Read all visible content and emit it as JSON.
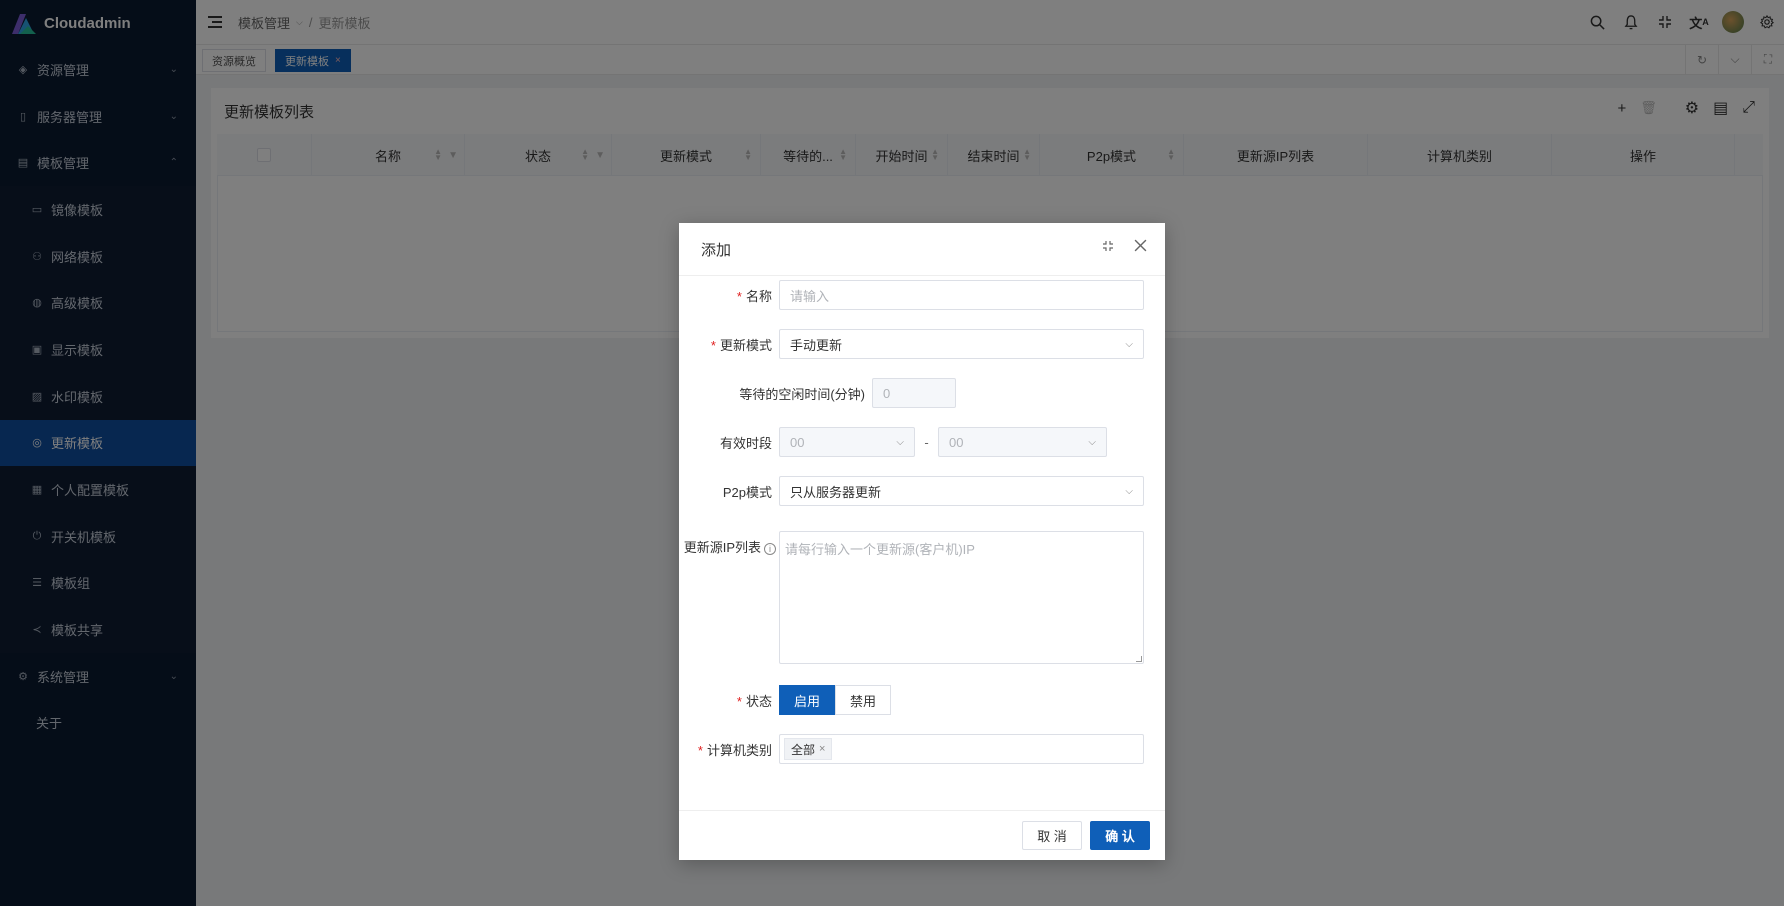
{
  "app": {
    "name": "Cloudadmin"
  },
  "sidebar": {
    "items": [
      {
        "label": "资源管理",
        "icon": "resource-icon",
        "type": "top",
        "expanded": false
      },
      {
        "label": "服务器管理",
        "icon": "server-icon",
        "type": "top",
        "expanded": false
      },
      {
        "label": "模板管理",
        "icon": "template-icon",
        "type": "top",
        "expanded": true
      },
      {
        "label": "镜像模板",
        "icon": "disk-icon",
        "type": "sub"
      },
      {
        "label": "网络模板",
        "icon": "network-icon",
        "type": "sub"
      },
      {
        "label": "高级模板",
        "icon": "advanced-icon",
        "type": "sub"
      },
      {
        "label": "显示模板",
        "icon": "display-icon",
        "type": "sub"
      },
      {
        "label": "水印模板",
        "icon": "watermark-icon",
        "type": "sub"
      },
      {
        "label": "更新模板",
        "icon": "update-icon",
        "type": "sub",
        "active": true
      },
      {
        "label": "个人配置模板",
        "icon": "profile-icon",
        "type": "sub"
      },
      {
        "label": "开关机模板",
        "icon": "power-icon",
        "type": "sub"
      },
      {
        "label": "模板组",
        "icon": "group-icon",
        "type": "sub"
      },
      {
        "label": "模板共享",
        "icon": "share-icon",
        "type": "sub"
      },
      {
        "label": "系统管理",
        "icon": "settings-icon",
        "type": "top",
        "expanded": false
      },
      {
        "label": "关于",
        "icon": "",
        "type": "plain"
      }
    ]
  },
  "topbar": {
    "breadcrumb": [
      "模板管理",
      "更新模板"
    ],
    "icons": [
      "search-icon",
      "bell-icon",
      "fullscreen-icon",
      "translate-icon",
      "avatar",
      "gear-icon"
    ]
  },
  "tabs": [
    {
      "label": "资源概览",
      "active": false
    },
    {
      "label": "更新模板",
      "active": true,
      "close": "×"
    }
  ],
  "card": {
    "title": "更新模板列表",
    "columns": [
      "名称",
      "状态",
      "更新模式",
      "等待的...",
      "开始时间",
      "结束时间",
      "P2p模式",
      "更新源IP列表",
      "计算机类别",
      "操作"
    ]
  },
  "modal": {
    "title": "添加",
    "fields": {
      "name": {
        "label": "名称",
        "placeholder": "请输入"
      },
      "update_mode": {
        "label": "更新模式",
        "value": "手动更新"
      },
      "idle_wait": {
        "label": "等待的空闲时间(分钟)",
        "value": "0"
      },
      "valid_period": {
        "label": "有效时段",
        "start": "00",
        "end": "00",
        "sep": "-"
      },
      "p2p": {
        "label": "P2p模式",
        "value": "只从服务器更新"
      },
      "source_ips": {
        "label": "更新源IP列表",
        "placeholder": "请每行输入一个更新源(客户机)IP"
      },
      "status": {
        "label": "状态",
        "on": "启用",
        "off": "禁用"
      },
      "computer_type": {
        "label": "计算机类别",
        "tag": "全部"
      }
    },
    "cancel": "取 消",
    "confirm": "确 认"
  },
  "colors": {
    "primary": "#0f5fb8",
    "sidebar_bg": "#0b1a30",
    "required": "#e02020"
  }
}
